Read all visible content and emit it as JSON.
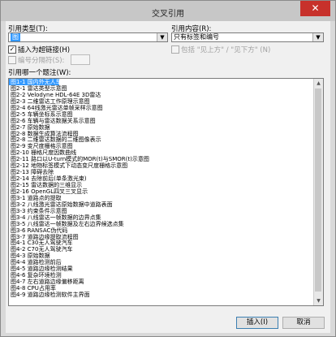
{
  "window": {
    "title": "交叉引用",
    "close_glyph": "✕"
  },
  "ref_type": {
    "label": "引用类型(T):",
    "value": "图"
  },
  "ref_content": {
    "label": "引用内容(R):",
    "value": "只有标签和编号"
  },
  "insert_hyperlink": {
    "label": "插入为超链接(H)",
    "checked": true
  },
  "include_above_below": {
    "label": "包括 \"见上方\" / \"见下方\" (N)"
  },
  "separator": {
    "label": "编号分隔符(S):"
  },
  "list": {
    "label": "引用哪一个题注(W):",
    "items": [
      "图1-1 国内外无人车测试",
      "图2-1 雷达类型示意图",
      "图2-2 Velodyne HDL-64E 3D雷达",
      "图2-3 二维雷达工作原理示意图",
      "图2-4 64线激光雷达单帧采样示意图",
      "图2-5 车辆坐标系示意图",
      "图2-6 车辆与雷达数据关系示意图",
      "图2-7 原始数据",
      "图2-8 数据生成算法流程图",
      "图2-8 二维雷达数据的二维图像表示",
      "图2-9 变尺度栅格示意图",
      "图2-10 栅格尺度因数曲线",
      "图2-11 路口以U-turn模式的MOR(t)与SMOR(t)示意图",
      "图2-12 地物标签模式下动态变尺度栅格示意图",
      "图2-13 障碍去除",
      "图2-14 去除前后(单条激光束)",
      "图2-15 雷达数据的三维显示",
      "图2-16 OpenGL四叉三叉显示",
      "图3-1 道路点的提取",
      "图3-2 八线激光雷达原始数据中道路表面",
      "图3-3 约束条件示意图",
      "图3-4 八线雷达一帧数据的边界点集",
      "图3-5 八线雷达一帧数据及左右边界候选点集",
      "图3-6 RANSAC伪代码",
      "图3-7 道路边缘提取流程图",
      "图4-1 C30无人驾驶汽车",
      "图4-2 C70无人驾驶汽车",
      "图4-3 原始数据",
      "图4-4 道路检测前后",
      "图4-5 道路边缘检测结果",
      "图4-6 复杂环境检测",
      "图4-7 左右道路边缘偏移距离",
      "图4-8 CPU占用率",
      "图4-9 道路边缘检测软件主界面"
    ]
  },
  "buttons": {
    "insert": "插入(I)",
    "cancel": "取消"
  },
  "scroll": {
    "up_glyph": "▲",
    "down_glyph": "▼"
  },
  "colors": {
    "selection": "#3399ff",
    "close": "#c7312b"
  }
}
